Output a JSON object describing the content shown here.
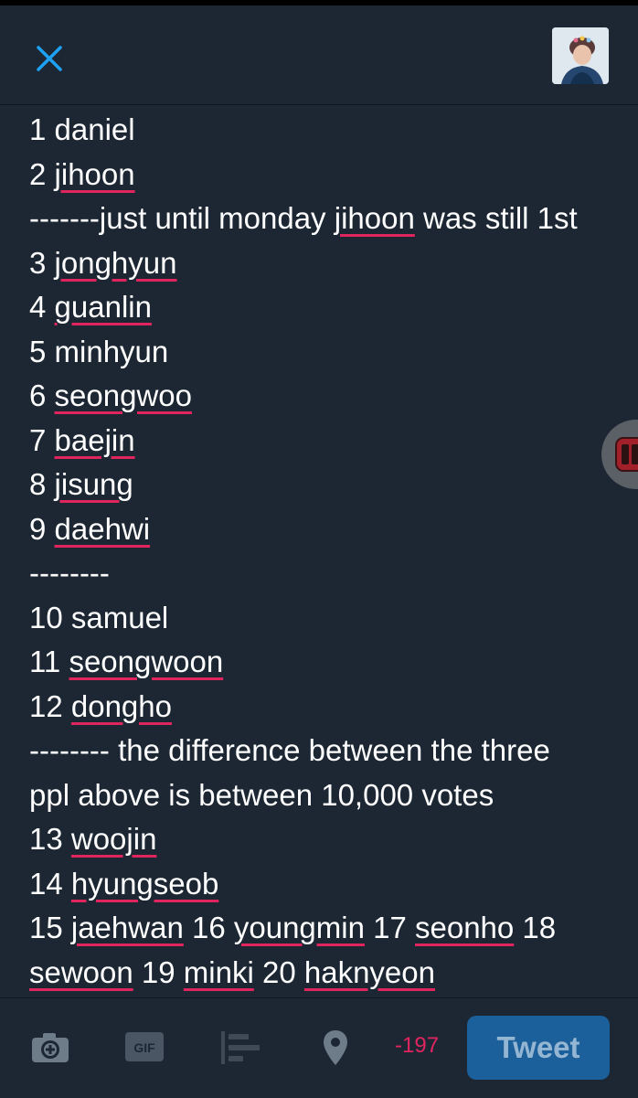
{
  "header": {
    "close_icon": "close-icon",
    "avatar_icon": "profile-avatar"
  },
  "compose": {
    "lines": [
      [
        {
          "t": "1 daniel"
        }
      ],
      [
        {
          "t": "2 "
        },
        {
          "t": "jihoon",
          "sp": true
        }
      ],
      [
        {
          "t": "-------just until monday "
        },
        {
          "t": "jihoon",
          "sp": true
        },
        {
          "t": " was still 1st"
        }
      ],
      [
        {
          "t": "3 "
        },
        {
          "t": "jonghyun",
          "sp": true
        }
      ],
      [
        {
          "t": "4 "
        },
        {
          "t": "guanlin",
          "sp": true
        }
      ],
      [
        {
          "t": "5 minhyun"
        }
      ],
      [
        {
          "t": "6 "
        },
        {
          "t": "seongwoo",
          "sp": true
        }
      ],
      [
        {
          "t": "7 "
        },
        {
          "t": "baejin",
          "sp": true
        }
      ],
      [
        {
          "t": "8 "
        },
        {
          "t": "jisung",
          "sp": true
        }
      ],
      [
        {
          "t": "9 "
        },
        {
          "t": "daehwi",
          "sp": true
        }
      ],
      [
        {
          "t": "--------"
        }
      ],
      [
        {
          "t": "10 samuel"
        }
      ],
      [
        {
          "t": "11 "
        },
        {
          "t": "seongwoon",
          "sp": true
        }
      ],
      [
        {
          "t": "12 "
        },
        {
          "t": "dongho",
          "sp": true
        }
      ],
      [
        {
          "t": "-------- the difference between the three"
        }
      ],
      [
        {
          "t": "ppl above is between 10,000 votes"
        }
      ],
      [
        {
          "t": "13 "
        },
        {
          "t": "woojin",
          "sp": true
        }
      ],
      [
        {
          "t": "14 "
        },
        {
          "t": "hyungseob",
          "sp": true
        }
      ],
      [
        {
          "t": "15 "
        },
        {
          "t": "jaehwan",
          "sp": true
        },
        {
          "t": " 16 "
        },
        {
          "t": "youngmin",
          "sp": true
        },
        {
          "t": " 17 "
        },
        {
          "t": "seonho",
          "sp": true
        },
        {
          "t": " 18"
        }
      ],
      [
        {
          "t": "sewoon",
          "sp": true
        },
        {
          "t": " 19 "
        },
        {
          "t": "minki",
          "sp": true
        },
        {
          "t": " 20 "
        },
        {
          "t": "haknyeon",
          "sp": true
        }
      ]
    ]
  },
  "toolbar": {
    "icons": [
      "camera-icon",
      "gif-icon",
      "poll-icon",
      "location-icon"
    ],
    "gif_label": "GIF",
    "char_counter": "-197",
    "tweet_label": "Tweet"
  },
  "colors": {
    "background": "#1c2733",
    "accent": "#1da1f2",
    "spellcheck_underline": "#e0245e",
    "counter": "#e0245e",
    "tweet_button": "#1b5f9b",
    "icon": "#6e7c8a"
  }
}
